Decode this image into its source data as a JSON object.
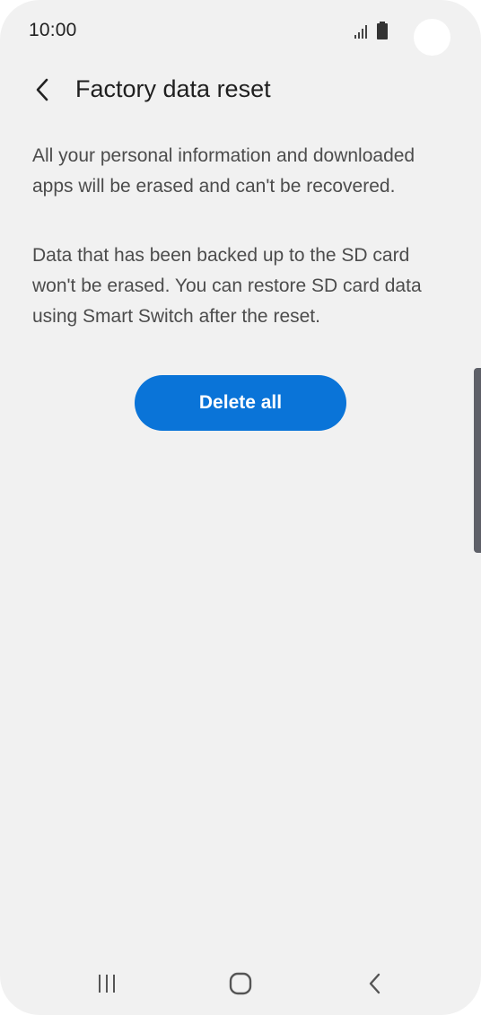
{
  "status_bar": {
    "time": "10:00",
    "icons": [
      "signal-icon",
      "battery-icon"
    ]
  },
  "header": {
    "back_icon": "chevron-left-icon",
    "title": "Factory data reset"
  },
  "content": {
    "paragraph_1": "All your personal information and downloaded apps will be erased and can't be recovered.",
    "paragraph_2": "Data that has been backed up to the SD card won't be erased. You can restore SD card data using Smart Switch after the reset."
  },
  "actions": {
    "delete_all_label": "Delete all"
  },
  "nav_bar": {
    "icons": [
      "recents-icon",
      "home-icon",
      "back-icon"
    ]
  },
  "colors": {
    "background": "#f1f1f1",
    "accent": "#0a74d8",
    "button_text": "#ffffff",
    "title_text": "#1f1f1f",
    "body_text": "#4c4c4c"
  }
}
